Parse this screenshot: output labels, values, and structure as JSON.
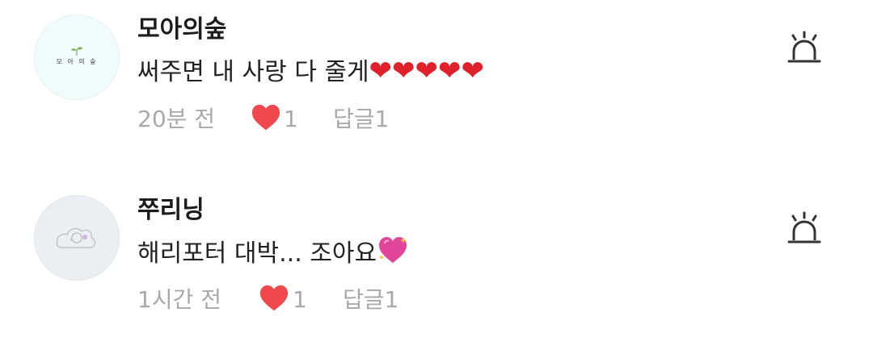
{
  "comments": [
    {
      "avatar_text": "모 아 의 숲",
      "username": "모아의숲",
      "text": "써주면 내 사랑 다 줄게",
      "emoji": "❤❤❤❤❤",
      "time": "20분 전",
      "likes": "1",
      "reply_label": "답글",
      "reply_count": "1"
    },
    {
      "username": "쭈리닝",
      "text": "해리포터 대박... 조아요",
      "emoji": "💖",
      "time": "1시간 전",
      "likes": "1",
      "reply_label": "답글",
      "reply_count": "1"
    }
  ],
  "colors": {
    "heart": "#f0484c",
    "meta": "#a9a9a9",
    "username": "#1c1c1c"
  },
  "icons": {
    "report": "siren-icon",
    "like": "heart-icon"
  }
}
